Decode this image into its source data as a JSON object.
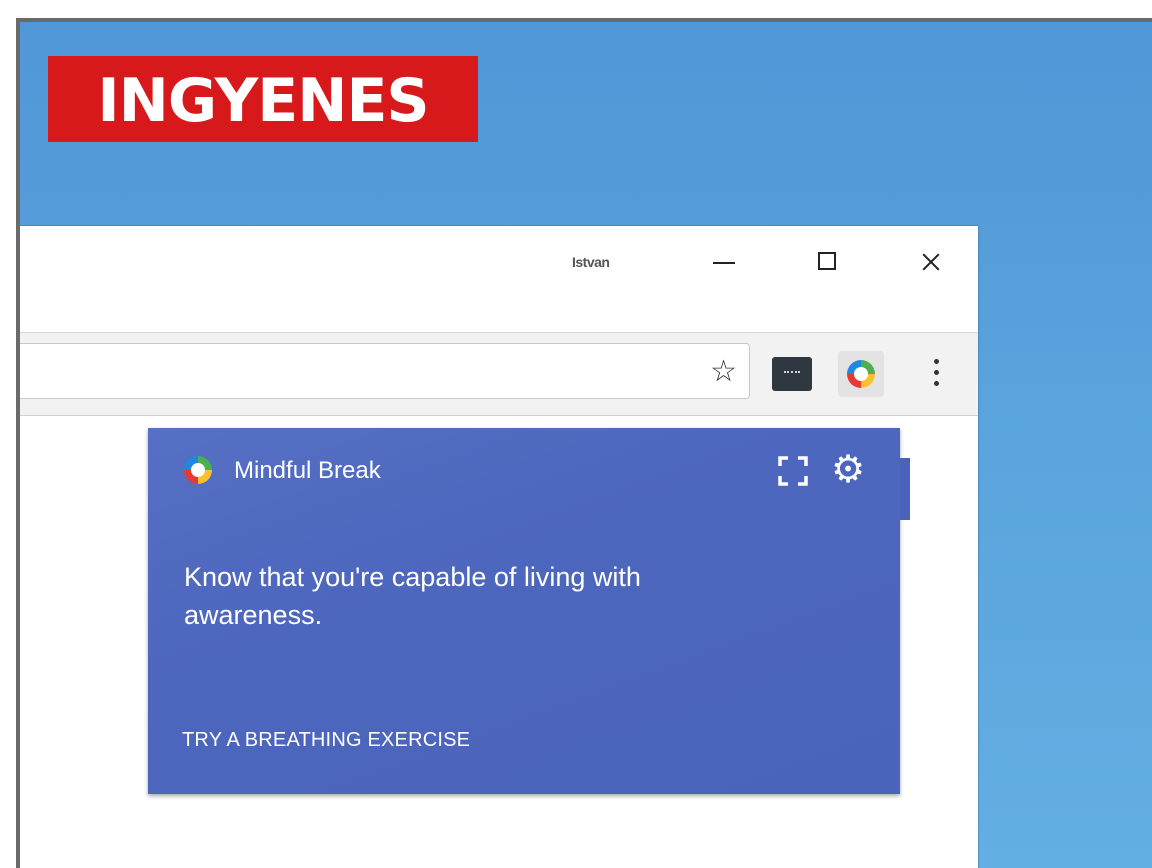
{
  "badge": {
    "text": "INGYENES"
  },
  "browser": {
    "titlebar": {
      "user_label": "Istvan",
      "minimize_label": "Minimize",
      "maximize_label": "Maximize",
      "close_label": "Close"
    },
    "toolbar": {
      "bookmark_icon": "star-icon",
      "extensions": [
        "extension-icon",
        "mindful-break-extension-icon"
      ],
      "menu_icon": "kebab-menu-icon"
    }
  },
  "popup": {
    "title": "Mindful Break",
    "message": "Know that you're capable of living with awareness.",
    "action": "TRY A BREATHING EXERCISE",
    "colors": {
      "background": "#4d66be",
      "text": "#ffffff"
    },
    "icons": [
      "mindful-break-logo-icon",
      "expand-icon",
      "gear-icon"
    ]
  },
  "colors": {
    "badge": "#d7191c",
    "desktop": "#5aa3dd"
  }
}
